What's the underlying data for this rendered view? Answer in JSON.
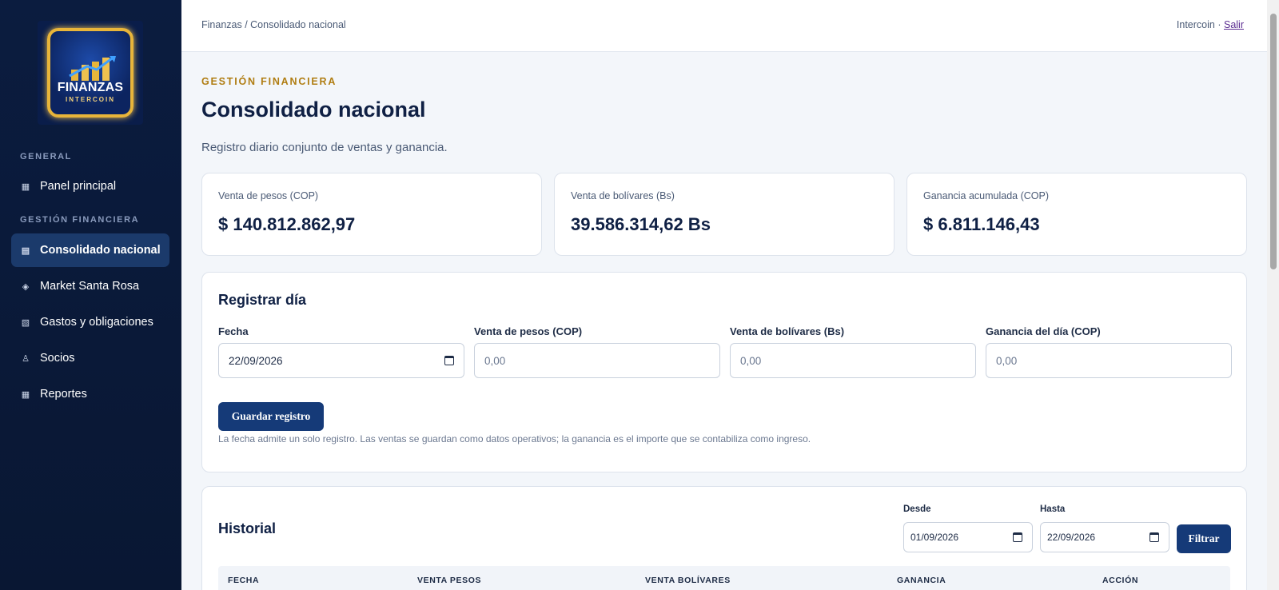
{
  "sidebar": {
    "logo": {
      "line1": "FINANZAS",
      "line2": "INTERCOIN"
    },
    "sections": [
      {
        "title": "GENERAL"
      },
      {
        "title": "GESTIÓN FINANCIERA"
      }
    ],
    "items": [
      {
        "label": "Panel principal",
        "icon": "grid-icon"
      },
      {
        "label": "Consolidado nacional",
        "icon": "list-icon",
        "active": true
      },
      {
        "label": "Market Santa Rosa",
        "icon": "diamond-icon"
      },
      {
        "label": "Gastos y obligaciones",
        "icon": "striped-box-icon"
      },
      {
        "label": "Socios",
        "icon": "person-icon"
      },
      {
        "label": "Reportes",
        "icon": "table-icon"
      }
    ]
  },
  "topbar": {
    "breadcrumb": "Finanzas / Consolidado nacional",
    "user": "Intercoin ·",
    "logout": "Salir"
  },
  "header": {
    "kicker": "GESTIÓN FINANCIERA",
    "title": "Consolidado nacional",
    "subtitle": "Registro diario conjunto de ventas y ganancia."
  },
  "stats": [
    {
      "label": "Venta de pesos (COP)",
      "value": "$ 140.812.862,97"
    },
    {
      "label": "Venta de bolívares (Bs)",
      "value": "39.586.314,62 Bs"
    },
    {
      "label": "Ganancia acumulada (COP)",
      "value": "$ 6.811.146,43"
    }
  ],
  "register": {
    "title": "Registrar día",
    "fields": [
      {
        "label": "Fecha",
        "value": "22/09/2026"
      },
      {
        "label": "Venta de pesos (COP)",
        "placeholder": "0,00"
      },
      {
        "label": "Venta de bolívares (Bs)",
        "placeholder": "0,00"
      },
      {
        "label": "Ganancia del día (COP)",
        "placeholder": "0,00"
      }
    ],
    "save_label": "Guardar registro",
    "hint": "La fecha admite un solo registro. Las ventas se guardan como datos operativos; la ganancia es el importe que se contabiliza como ingreso."
  },
  "history": {
    "title": "Historial",
    "from_label": "Desde",
    "from_value": "01/09/2026",
    "to_label": "Hasta",
    "to_value": "22/09/2026",
    "filter_label": "Filtrar",
    "columns": [
      "FECHA",
      "VENTA PESOS",
      "VENTA BOLÍVARES",
      "GANANCIA",
      "ACCIÓN"
    ]
  },
  "colors": {
    "sidebar_bg": "#0b1c3f",
    "active_item": "#1b3a6b",
    "primary": "#153a78",
    "accent_gold": "#b07d12"
  }
}
